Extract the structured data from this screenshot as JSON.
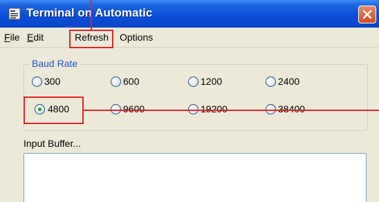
{
  "window": {
    "title": "Terminal on Automatic",
    "icon": "terminal-app-icon",
    "close_icon": "close-icon"
  },
  "menu": {
    "file": "File",
    "edit": "Edit",
    "refresh": "Refresh",
    "options": "Options"
  },
  "baud": {
    "label": "Baud Rate",
    "options": [
      "300",
      "600",
      "1200",
      "2400",
      "4800",
      "9600",
      "19200",
      "38400"
    ],
    "selected": "4800"
  },
  "input_buffer": {
    "label": "Input Buffer...",
    "value": ""
  },
  "colors": {
    "titlebar": "#0b4fd8",
    "annotation": "#e0252c",
    "group_label": "#2450c8",
    "radio_selected_dot": "#21a121"
  }
}
